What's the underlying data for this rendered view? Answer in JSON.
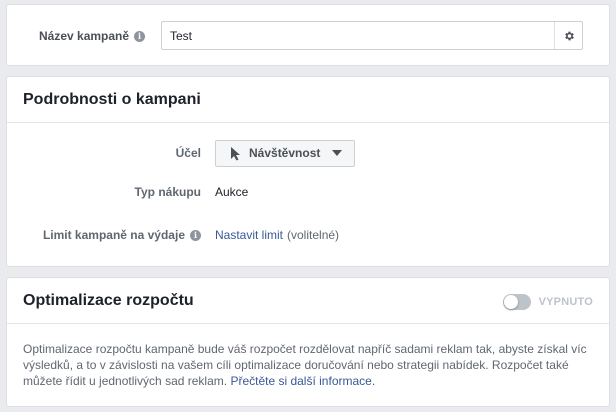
{
  "campaign_name": {
    "label": "Název kampaně",
    "value": "Test",
    "info_icon": "info-icon",
    "settings_icon": "gear-icon"
  },
  "details": {
    "title": "Podrobnosti o kampani",
    "objective": {
      "label": "Účel",
      "value": "Návštěvnost",
      "icon": "cursor-icon"
    },
    "buying_type": {
      "label": "Typ nákupu",
      "value": "Aukce"
    },
    "spending_limit": {
      "label": "Limit kampaně na výdaje",
      "link": "Nastavit limit",
      "note": "(volitelné)"
    }
  },
  "budget_optimization": {
    "title": "Optimalizace rozpočtu",
    "toggle_label": "VYPNUTO",
    "toggle_on": false,
    "description": "Optimalizace rozpočtu kampaně bude váš rozpočet rozdělovat napříč sadami reklam tak, abyste získal víc výsledků, a to v závislosti na vašem cíli optimalizace doručování nebo strategii nabídek. Rozpočet také můžete řídit u jednotlivých sad reklam.",
    "learn_more": "Přečtěte si další informace."
  },
  "colors": {
    "link": "#385898",
    "background": "#e9ebee",
    "toggle_off": "#bec3c9"
  }
}
